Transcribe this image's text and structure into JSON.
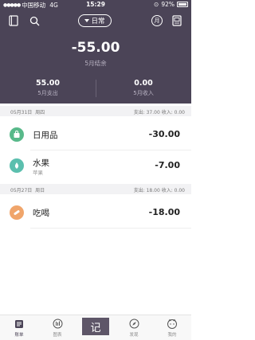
{
  "status_bar": {
    "carrier": "中国移动",
    "network": "4G",
    "time": "15:29",
    "battery": "92%"
  },
  "header": {
    "type_selector": "日常",
    "balance": "-55.00",
    "balance_label": "5月结余",
    "expense_value": "55.00",
    "expense_label": "5月支出",
    "income_value": "0.00",
    "income_label": "5月收入",
    "month_icon_label": "月"
  },
  "days": [
    {
      "date": "05月31日",
      "weekday": "周四",
      "summary": "支出: 37.00   收入: 0.00",
      "items": [
        {
          "name": "日用品",
          "note": "",
          "amount": "-30.00",
          "icon": "shopping-bag-icon",
          "color": "#58b98a"
        },
        {
          "name": "水果",
          "note": "苹果",
          "amount": "-7.00",
          "icon": "fruit-icon",
          "color": "#5bbfae"
        }
      ]
    },
    {
      "date": "05月27日",
      "weekday": "周日",
      "summary": "支出: 18.00   收入: 0.00",
      "items": [
        {
          "name": "吃喝",
          "note": "",
          "amount": "-18.00",
          "icon": "food-icon",
          "color": "#f0a56b"
        }
      ]
    }
  ],
  "tabbar": {
    "ledger": "账单",
    "chart": "图表",
    "record": "记",
    "discover": "发现",
    "mine": "我的"
  },
  "colors": {
    "header_bg": "#4b4457",
    "accent": "#5e5668"
  }
}
